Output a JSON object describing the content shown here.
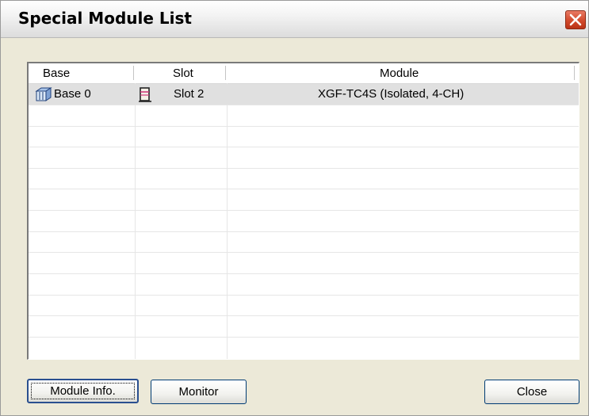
{
  "window": {
    "title": "Special Module List"
  },
  "list": {
    "columns": [
      "Base",
      "Slot",
      "Module"
    ],
    "rows": [
      {
        "base": "Base 0",
        "slot": "Slot 2",
        "module": "XGF-TC4S (Isolated, 4-CH)",
        "base_icon": "base-rack-icon",
        "slot_icon": "module-slot-icon"
      }
    ]
  },
  "buttons": {
    "module_info": "Module Info.",
    "monitor": "Monitor",
    "close": "Close"
  },
  "colors": {
    "selected_row": "#e0e0e0",
    "dialog_bg": "#ece9d8",
    "close_button": "#d24a2c"
  }
}
